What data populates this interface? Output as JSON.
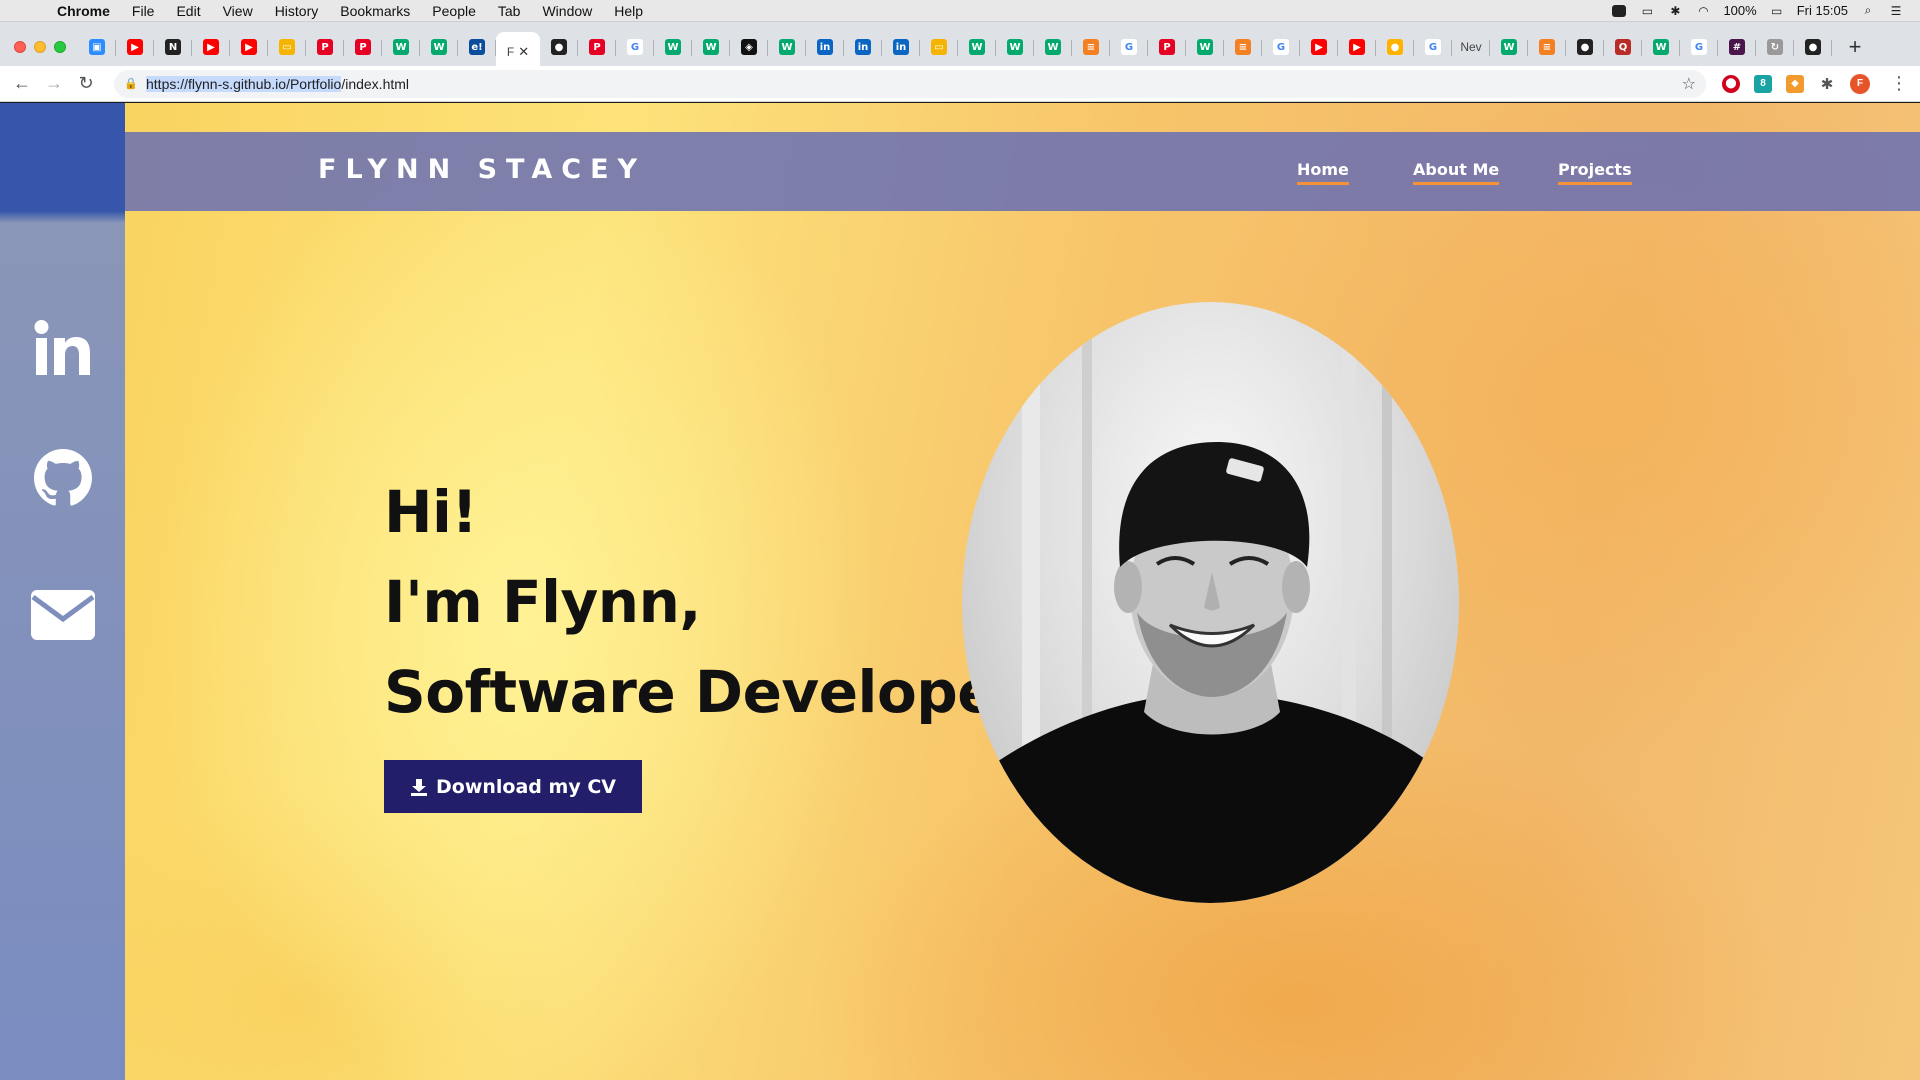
{
  "menubar": {
    "app": "Chrome",
    "items": [
      "File",
      "Edit",
      "View",
      "History",
      "Bookmarks",
      "People",
      "Tab",
      "Window",
      "Help"
    ],
    "battery": "100%",
    "clock": "Fri 15:05"
  },
  "tabs": {
    "favicons_left": [
      "zoom",
      "youtube",
      "notion",
      "youtube",
      "youtube",
      "slides",
      "pinterest",
      "pinterest",
      "w3schools",
      "w3schools",
      "e!"
    ],
    "active_title": "F",
    "favicons_right": [
      "github",
      "pinterest",
      "google",
      "w3schools",
      "w3schools",
      "codepen",
      "w3schools",
      "linkedin",
      "linkedin",
      "linkedin",
      "slides",
      "w3schools",
      "w3schools",
      "w3schools",
      "stackoverflow",
      "google",
      "pinterest",
      "w3schools",
      "stackoverflow",
      "google",
      "youtube",
      "youtube",
      "colors",
      "google"
    ],
    "new_tab_text": "Nev",
    "favicons_tail": [
      "w3schools",
      "stackoverflow",
      "github",
      "quora",
      "w3schools",
      "google",
      "slack",
      "sync",
      "github"
    ]
  },
  "toolbar": {
    "url_selected": "https://flynn-s.github.io/Portfolio",
    "url_rest": "/index.html",
    "profile_initial": "F"
  },
  "page": {
    "brand": "FLYNN STACEY",
    "nav": [
      "Home",
      "About Me",
      "Projects"
    ],
    "hero": [
      "Hi!",
      "I'm Flynn,",
      "Software Developer"
    ],
    "cv_button": "Download my CV",
    "social": [
      "linkedin-icon",
      "github-icon",
      "envelope-icon"
    ]
  }
}
